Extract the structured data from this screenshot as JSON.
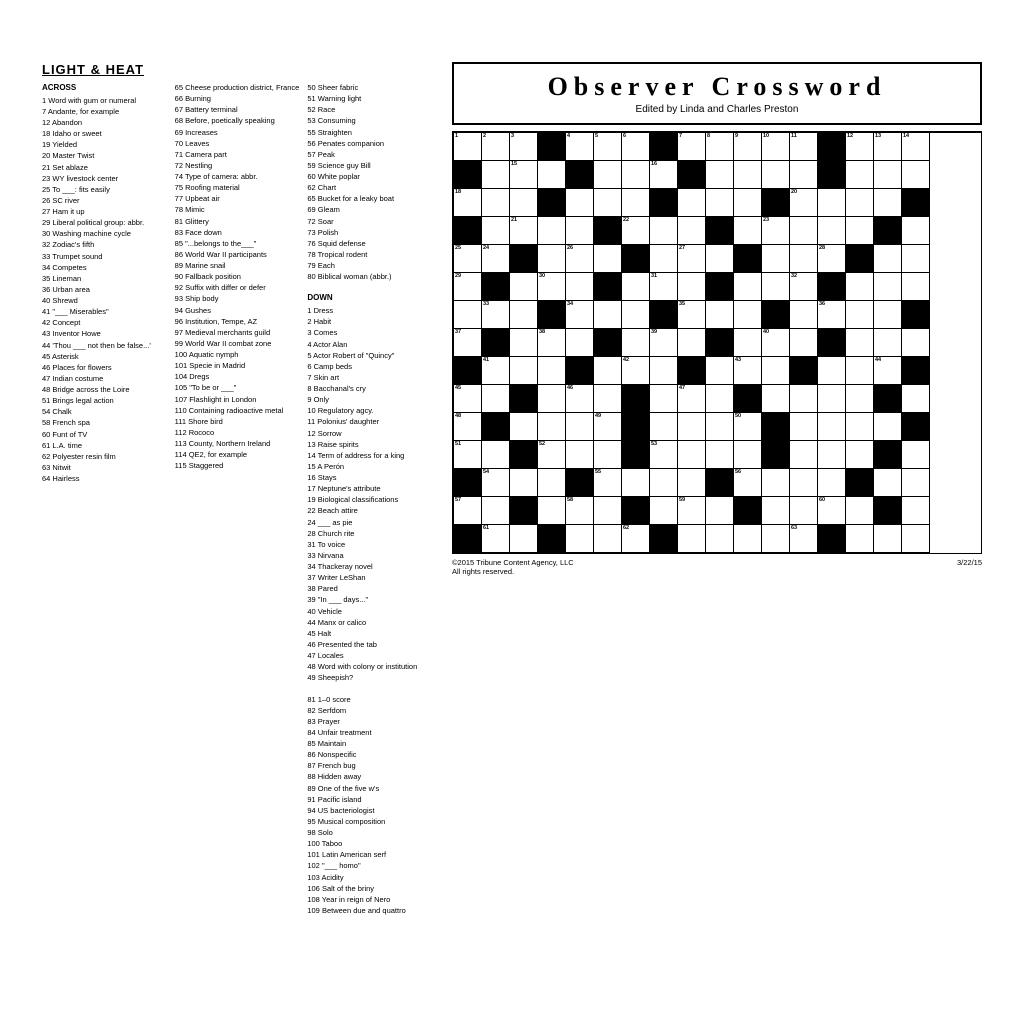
{
  "left": {
    "title": "LIGHT & HEAT",
    "across_title": "ACROSS",
    "down_title": "DOWN",
    "across_clues": [
      "1 Word with gum or numeral",
      "7 Andante, for example",
      "12 Abandon",
      "18 Idaho or sweet",
      "19 Yielded",
      "20 Master Twist",
      "21 Set ablaze",
      "23 WY livestock center",
      "25 To ___: fits easily",
      "26 SC river",
      "27 Ham it up",
      "29 Liberal political group: abbr.",
      "30 Washing machine cycle",
      "32 Zodiac's fifth",
      "33 Trumpet sound",
      "34 Competes",
      "35 Lineman",
      "36 Urban area",
      "40 Shrewd",
      "41 \"___ Miserables\"",
      "42 Concept",
      "43 Inventor Howe",
      "44 'Thou ___ not then be false...'",
      "45 Asterisk",
      "46 Places for flowers",
      "47 Indian costume",
      "48 Bridge across the Loire",
      "51 Brings legal action",
      "54 Chalk",
      "58 French spa",
      "60 Funt of TV",
      "61 L.A. time",
      "62 Polyester resin film",
      "63 Nitwit",
      "64 Hairless",
      "65 Cheese production district, France",
      "66 Burning",
      "67 Battery terminal",
      "68 Before, poetically speaking",
      "69 Increases",
      "70 Leaves",
      "71 Camera part",
      "72 Nestling",
      "74 Type of camera: abbr.",
      "75 Roofing material",
      "77 Upbeat air",
      "78 Mimic",
      "81 Glittery",
      "83 Face down",
      "85 \"...belongs to the___\"",
      "86 World War II participants",
      "89 Marine snail",
      "90 Fallback position",
      "92 Suffix with differ or defer",
      "93 Ship body",
      "94 Gushes",
      "96 Institution, Tempe, AZ",
      "97 Medieval merchants guild",
      "99 World War II combat zone",
      "100 Aquatic nymph",
      "101 Specie in Madrid",
      "104 Dregs",
      "105 \"To be or ___\"",
      "107 Flashlight in London",
      "110 Containing radioactive metal",
      "111 Shore bird",
      "112 Rococo",
      "113 County, Northern Ireland",
      "114 QE2, for example",
      "115 Staggered",
      "50 Sheer fabric",
      "51 Warning light",
      "52 Race",
      "53 Consuming",
      "55 Straighten",
      "56 Penates companion",
      "57 Peak",
      "59 Science guy Bill",
      "60 White poplar",
      "62 Chart",
      "65 Bucket for a leaky boat",
      "69 Gleam",
      "72 Soar",
      "73 Polish",
      "76 Squid defense",
      "78 Tropical rodent",
      "79 Each",
      "80 Biblical woman (abbr.)",
      "81 1–0 score",
      "82 Serfdom",
      "83 Prayer",
      "84 Unfair treatment",
      "85 Maintain",
      "86 Nonspecific",
      "87 French bug",
      "88 Hidden away",
      "89 One of the five w's",
      "91 Pacific island",
      "94 US bacteriologist",
      "95 Musical composition",
      "98 Solo",
      "100 Taboo",
      "101 Latin American serf",
      "102 \"___ homo\"",
      "103 Acidity",
      "106 Salt of the briny",
      "108 Year in reign of Nero",
      "109 Between due and quattro"
    ],
    "down_clues": [
      "1 Dress",
      "2 Habit",
      "3 Comes",
      "4 Actor Alan",
      "5 Actor Robert of \"Quincy\"",
      "6 Camp beds",
      "7 Skin art",
      "8 Bacchanal's cry",
      "9 Only",
      "10 Regulatory agcy.",
      "11 Polonius' daughter",
      "12 Sorrow",
      "13 Raise spirits",
      "14 Term of address for a king",
      "15 A Perón",
      "16 Stays",
      "17 Neptune's attribute",
      "19 Biological classifications",
      "22 Beach attire",
      "24 ___ as pie",
      "28 Church rite",
      "31 To voice",
      "33 Nirvana",
      "34 Thackeray novel",
      "37 Writer LeShan",
      "38 Pared",
      "39 \"In ___ days...\"",
      "40 Vehicle",
      "44 Manx or calico",
      "45 Halt",
      "46 Presented the tab",
      "47 Locales",
      "48 Word with colony or institution",
      "49 Sheepish?"
    ]
  },
  "right": {
    "header_title": "Observer Crossword",
    "header_subtitle": "Edited by Linda and Charles Preston",
    "footer_copyright": "©2015 Tribune Content Agency, LLC",
    "footer_rights": "All rights reserved.",
    "footer_date": "3/22/15"
  }
}
